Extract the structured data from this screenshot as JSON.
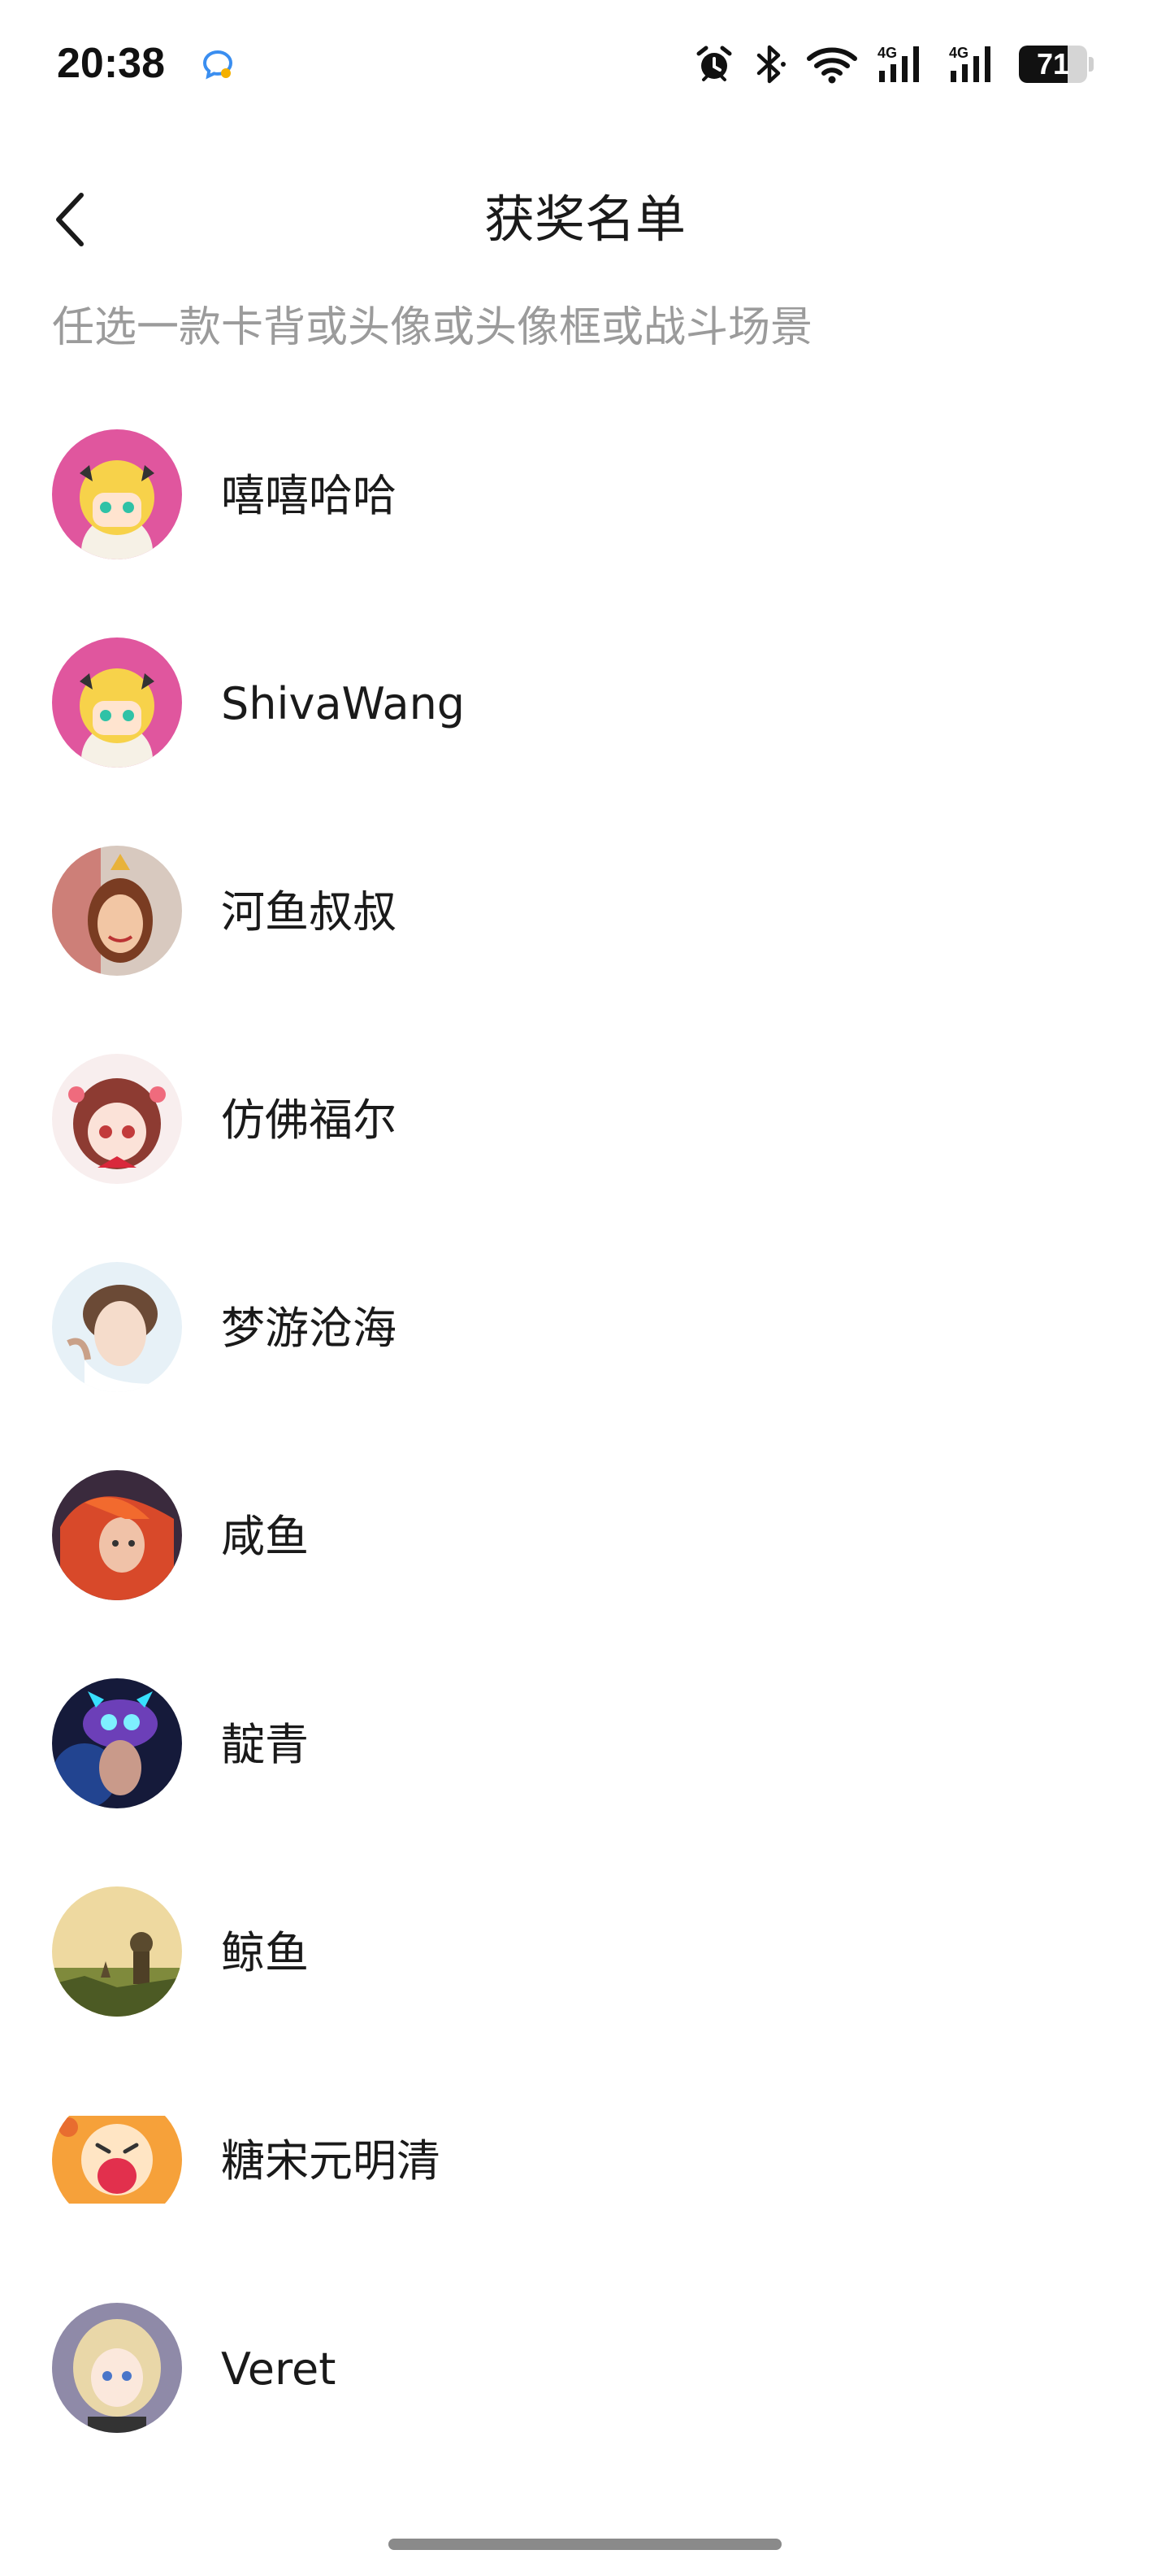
{
  "status_bar": {
    "time": "20:38",
    "app_icon": "chat-bubble-icon",
    "icons": [
      "alarm-icon",
      "bluetooth-icon",
      "wifi-icon",
      "signal-4g-icon",
      "signal-4g-icon"
    ],
    "network_1": "4G",
    "network_2": "4G",
    "battery_level": "71",
    "battery_percent": 71
  },
  "header": {
    "back_icon": "chevron-left-icon",
    "title": "获奖名单"
  },
  "subtitle": "任选一款卡背或头像或头像框或战斗场景",
  "winners": [
    {
      "name": "嘻嘻哈哈",
      "avatar_theme": "blonde-chibi-pink"
    },
    {
      "name": "ShivaWang",
      "avatar_theme": "blonde-chibi-pink"
    },
    {
      "name": "河鱼叔叔",
      "avatar_theme": "smiling-woman-portrait"
    },
    {
      "name": "仿佛福尔",
      "avatar_theme": "anime-girl-red-hair"
    },
    {
      "name": "梦游沧海",
      "avatar_theme": "anime-boy-brown-hair"
    },
    {
      "name": "咸鱼",
      "avatar_theme": "anime-red-hair"
    },
    {
      "name": "靛青",
      "avatar_theme": "neon-skull-hood"
    },
    {
      "name": "鲸鱼",
      "avatar_theme": "little-prince-sunset"
    },
    {
      "name": "糖宋元明清",
      "avatar_theme": "crying-cartoon-orange"
    },
    {
      "name": "Veret",
      "avatar_theme": "anime-girl-blonde-blue-eyes"
    }
  ],
  "colors": {
    "title_text": "#1a1a1a",
    "subtitle_text": "#9b9b9b",
    "background": "#ffffff",
    "home_indicator": "#8a8a8a"
  }
}
